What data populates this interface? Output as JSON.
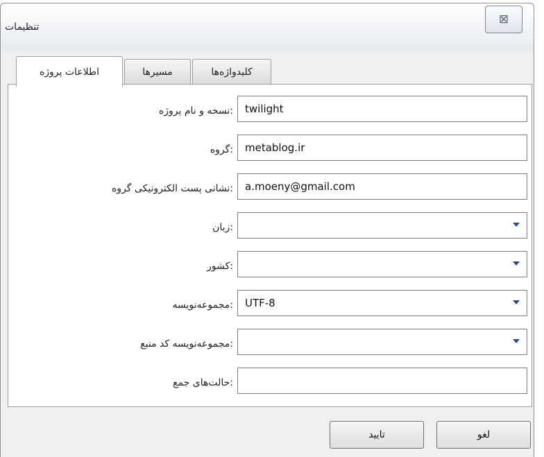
{
  "window": {
    "title": "تنظیمات",
    "close_symbol": "⊠"
  },
  "tabs": [
    {
      "label": "اطلاعات پروژه",
      "active": true
    },
    {
      "label": "مسیرها",
      "active": false
    },
    {
      "label": "کلیدواژه‌ها",
      "active": false
    }
  ],
  "form": {
    "fields": [
      {
        "label": ":نسخه و نام پروژه",
        "value": "twilight",
        "type": "text"
      },
      {
        "label": ":گروه",
        "value": "metablog.ir",
        "type": "text"
      },
      {
        "label": ":نشانی پست الکترونیکی گروه",
        "value": "a.moeny@gmail.com",
        "type": "text"
      },
      {
        "label": ":زبان",
        "value": "",
        "type": "select"
      },
      {
        "label": ":کشور",
        "value": "",
        "type": "select"
      },
      {
        "label": ":مجموعه‌نویسه",
        "value": "UTF-8",
        "type": "select"
      },
      {
        "label": ":مجموعه‌نویسه کد منبع",
        "value": "",
        "type": "select"
      },
      {
        "label": ":حالت‌های جمع",
        "value": "",
        "type": "text"
      }
    ]
  },
  "buttons": {
    "ok": "تایید",
    "cancel": "لغو"
  },
  "colors": {
    "dropdown_arrow": "#2c4c86",
    "window_bg": "#f0f0f0"
  }
}
